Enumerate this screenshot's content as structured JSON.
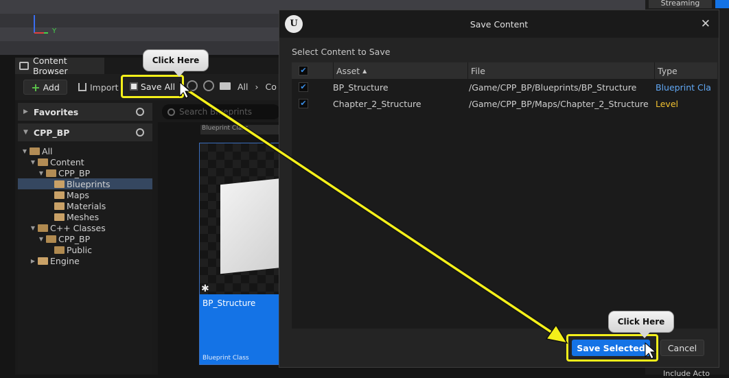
{
  "viewport": {
    "axis_y": "Y"
  },
  "right_panel": {
    "streaming": "Streaming",
    "include_label": "Include Acto"
  },
  "content_browser": {
    "tab_label": "Content Browser",
    "add_label": "Add",
    "import_label": "Import",
    "save_all_label": "Save All",
    "breadcrumb": [
      "All",
      "Co"
    ],
    "search_placeholder": "Search Blueprints",
    "favorites_label": "Favorites",
    "project_label": "CPP_BP",
    "tree": [
      {
        "label": "All",
        "indent": 0,
        "caret": "▼",
        "selected": false,
        "kind": "open"
      },
      {
        "label": "Content",
        "indent": 1,
        "caret": "▼",
        "selected": false,
        "kind": "open"
      },
      {
        "label": "CPP_BP",
        "indent": 2,
        "caret": "▼",
        "selected": false,
        "kind": "open"
      },
      {
        "label": "Blueprints",
        "indent": 3,
        "caret": "",
        "selected": true,
        "kind": "folder"
      },
      {
        "label": "Maps",
        "indent": 3,
        "caret": "",
        "selected": false,
        "kind": "folder"
      },
      {
        "label": "Materials",
        "indent": 3,
        "caret": "",
        "selected": false,
        "kind": "folder"
      },
      {
        "label": "Meshes",
        "indent": 3,
        "caret": "",
        "selected": false,
        "kind": "folder"
      },
      {
        "label": "C++ Classes",
        "indent": 1,
        "caret": "▼",
        "selected": false,
        "kind": "code"
      },
      {
        "label": "CPP_BP",
        "indent": 2,
        "caret": "▼",
        "selected": false,
        "kind": "code"
      },
      {
        "label": "Public",
        "indent": 3,
        "caret": "",
        "selected": false,
        "kind": "code"
      },
      {
        "label": "Engine",
        "indent": 1,
        "caret": "▶",
        "selected": false,
        "kind": "folder"
      }
    ],
    "asset": {
      "name": "BP_Structure",
      "type": "Blueprint Class",
      "type_above": "Blueprint Class"
    }
  },
  "dialog": {
    "title": "Save Content",
    "subtitle": "Select Content to Save",
    "columns": {
      "asset": "Asset",
      "file": "File",
      "type": "Type"
    },
    "rows": [
      {
        "asset": "BP_Structure",
        "file": "/Game/CPP_BP/Blueprints/BP_Structure",
        "type": "Blueprint Cla",
        "checked": true
      },
      {
        "asset": "Chapter_2_Structure",
        "file": "/Game/CPP_BP/Maps/Chapter_2_Structure",
        "type": "Level",
        "checked": true
      }
    ],
    "save_selected_label": "Save Selected",
    "cancel_label": "Cancel"
  },
  "callouts": {
    "top": "Click Here",
    "bottom": "Click Here"
  },
  "colors": {
    "highlight": "#f4f01a",
    "accent": "#1473e6",
    "blueprint": "#61a8f5",
    "level": "#f2c230"
  }
}
